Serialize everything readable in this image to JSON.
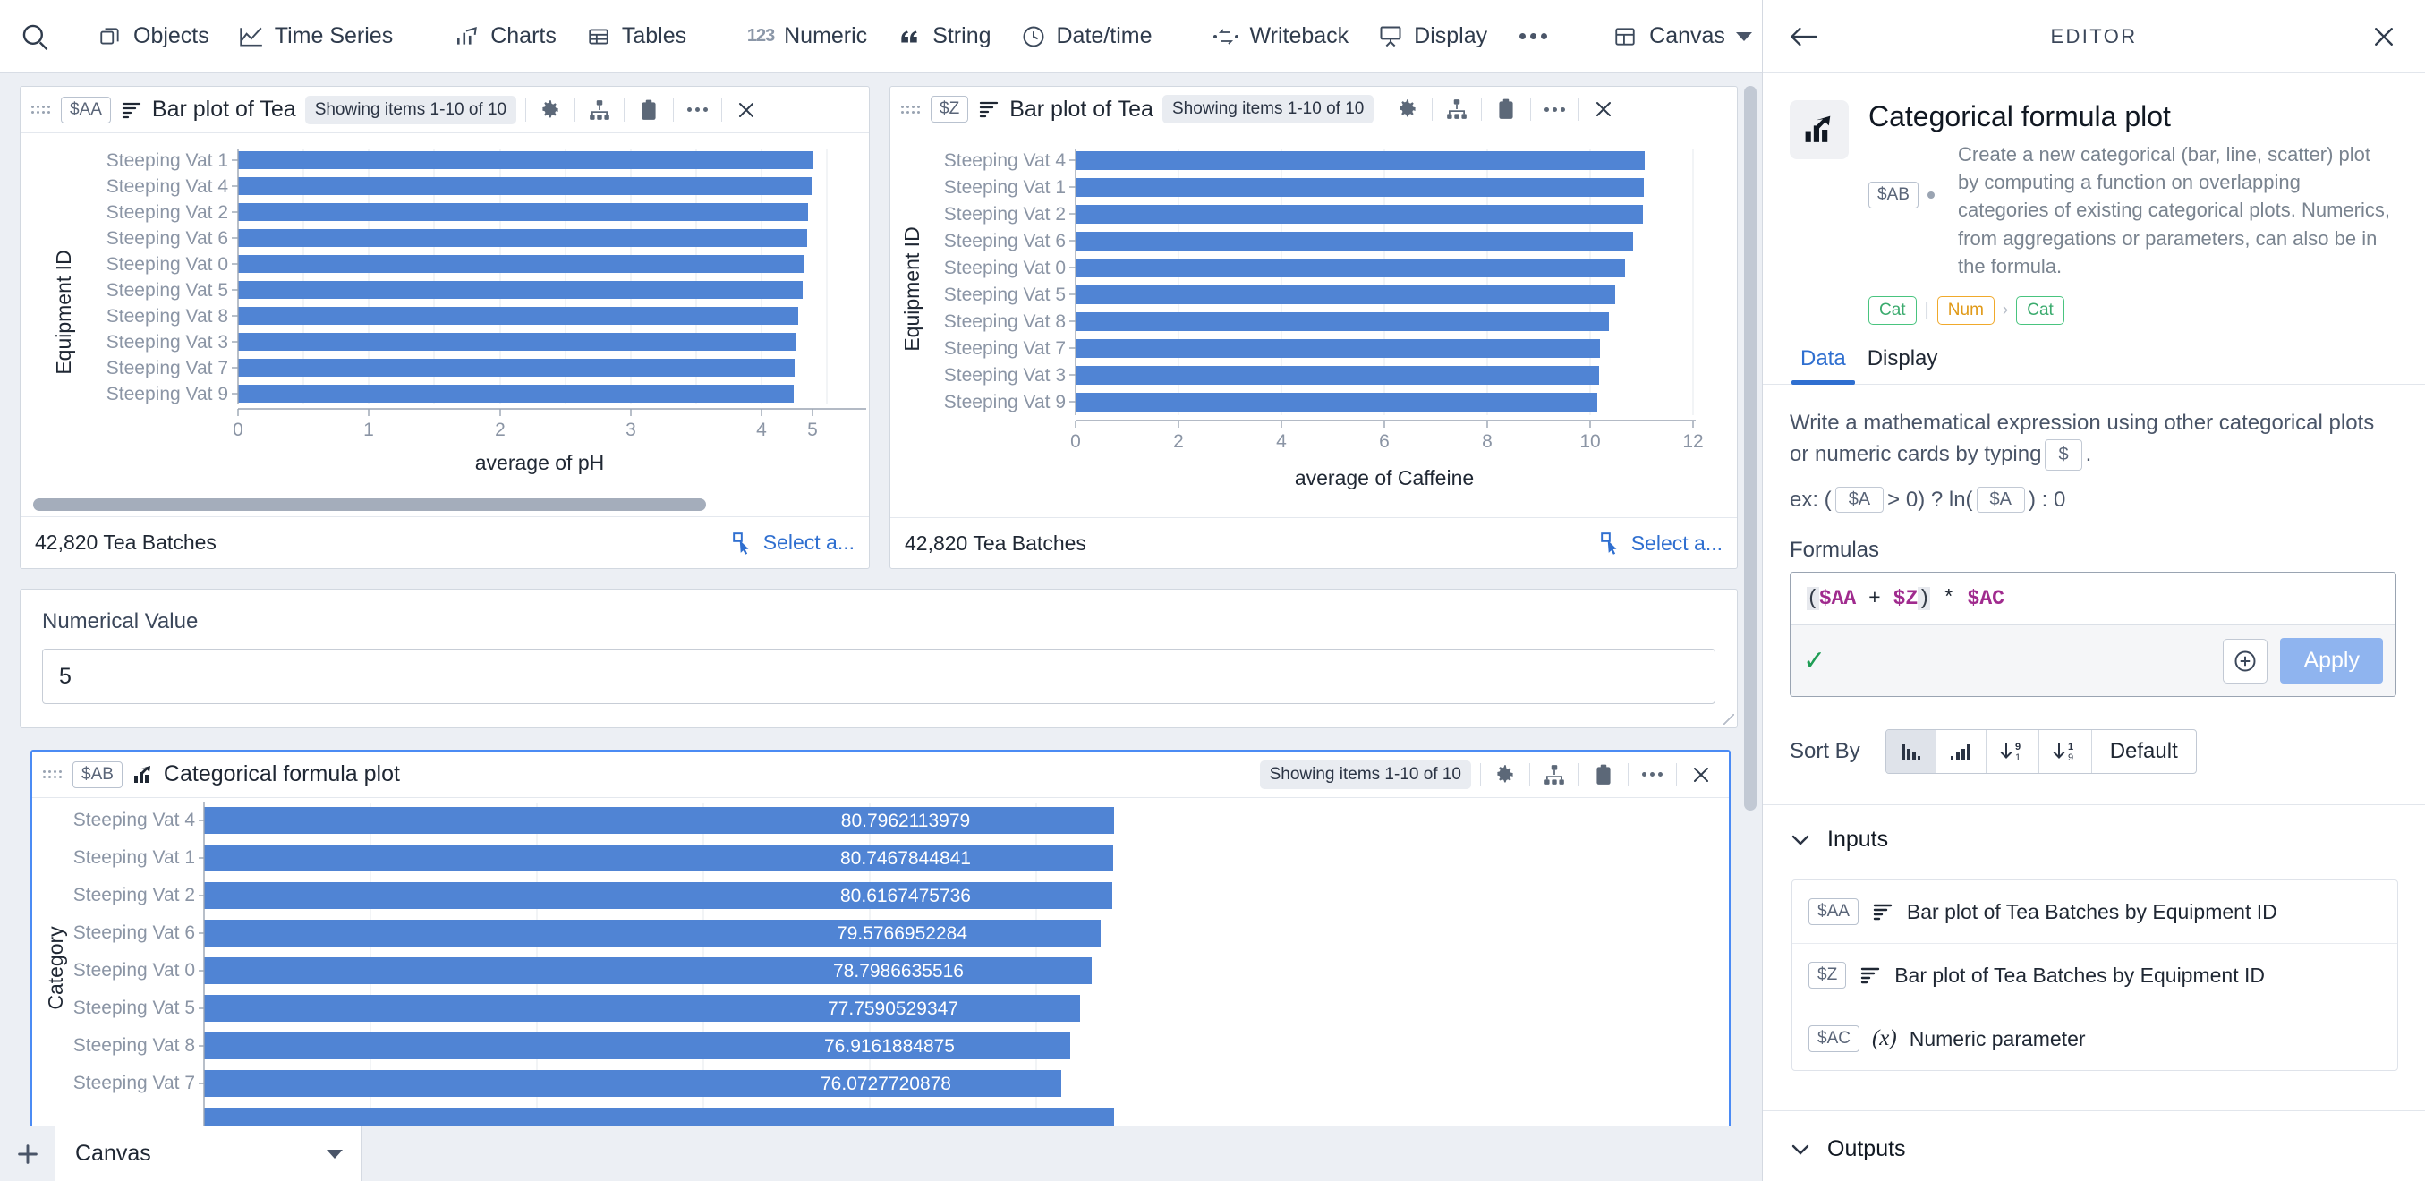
{
  "toolbar": {
    "search_icon": "search-icon",
    "items": [
      {
        "label": "Objects",
        "icon": "objects-icon"
      },
      {
        "label": "Time Series",
        "icon": "line-chart-icon"
      },
      {
        "label": "Charts",
        "icon": "bar-chart-icon"
      },
      {
        "label": "Tables",
        "icon": "table-icon"
      },
      {
        "label": "Numeric",
        "icon": "123-icon"
      },
      {
        "label": "String",
        "icon": "quote-icon"
      },
      {
        "label": "Date/time",
        "icon": "clock-icon"
      },
      {
        "label": "Writeback",
        "icon": "writeback-icon"
      },
      {
        "label": "Display",
        "icon": "presentation-icon"
      }
    ],
    "overflow_icon": "ellipsis-icon",
    "canvas_label": "Canvas",
    "canvas_caret": "chevron-down-icon"
  },
  "cards": [
    {
      "chip": "$AA",
      "title": "Bar plot of Tea",
      "showing": "Showing items 1-10 of 10",
      "footer_count": "42,820 Tea Batches",
      "footer_action": "Select a...",
      "has_scrollbar": true
    },
    {
      "chip": "$Z",
      "title": "Bar plot of Tea",
      "showing": "Showing items 1-10 of 10",
      "footer_count": "42,820 Tea Batches",
      "footer_action": "Select a...",
      "has_scrollbar": false
    }
  ],
  "numeric_card": {
    "label": "Numerical Value",
    "value": "5"
  },
  "formula_card": {
    "chip": "$AB",
    "title": "Categorical formula plot",
    "showing": "Showing items 1-10 of 10"
  },
  "bottom_bar": {
    "add_icon": "plus-icon",
    "tab_label": "Canvas",
    "tab_caret": "chevron-down-icon"
  },
  "editor": {
    "back_icon": "arrow-left-icon",
    "title": "EDITOR",
    "close_icon": "close-icon",
    "hero": {
      "icon": "trending-bar-icon",
      "title": "Categorical formula plot",
      "chip": "$AB",
      "description": "Create a new categorical (bar, line, scatter) plot by computing a function on overlapping categories of existing categorical plots. Numerics, from aggregations or parameters, can also be in the formula.",
      "type_in_a": "Cat",
      "type_in_b": "Num",
      "type_out": "Cat",
      "type_arrow": "›"
    },
    "tabs": [
      {
        "label": "Data",
        "active": true
      },
      {
        "label": "Display",
        "active": false
      }
    ],
    "help_text_1": "Write a mathematical expression using other categorical plots or numeric cards by typing",
    "help_chip": "$",
    "help_text_1_end": ".",
    "example_prefix": "ex: (",
    "example_chip_a": "$A",
    "example_mid": "> 0) ? ln(",
    "example_chip_b": "$A",
    "example_suffix": ") : 0",
    "formulas_label": "Formulas",
    "formula": {
      "open_paren": "(",
      "var1": "$AA",
      "op1": "+",
      "var2": "$Z",
      "close_paren": ")",
      "op2": "*",
      "var3": "$AC",
      "valid_icon": "check-icon",
      "add_icon": "plus-circle-icon",
      "apply_label": "Apply"
    },
    "sort": {
      "label": "Sort By",
      "options": [
        {
          "name": "sort-descending-bars",
          "active": true
        },
        {
          "name": "sort-ascending-bars",
          "active": false
        },
        {
          "name": "sort-9-to-1",
          "active": false,
          "top": "9",
          "bottom": "1"
        },
        {
          "name": "sort-1-to-9",
          "active": false,
          "top": "1",
          "bottom": "9"
        },
        {
          "name": "sort-default",
          "active": false,
          "label": "Default"
        }
      ]
    },
    "inputs": {
      "title": "Inputs",
      "chevron": "chevron-down-icon",
      "items": [
        {
          "chip": "$AA",
          "icon": "bar-plot-icon",
          "label": "Bar plot of Tea Batches by Equipment ID"
        },
        {
          "chip": "$Z",
          "icon": "bar-plot-icon",
          "label": "Bar plot of Tea Batches by Equipment ID"
        },
        {
          "chip": "$AC",
          "icon": "fx-icon",
          "label": "Numeric parameter"
        }
      ]
    },
    "outputs": {
      "title": "Outputs",
      "chevron": "chevron-down-icon"
    }
  },
  "colors": {
    "bar": "#5084d4",
    "accent": "#2f6fd0",
    "canvas_bg": "#eceff4",
    "chip_var": "#a02b8e",
    "valid_green": "#1f9d55",
    "cat_green": "#49c47f",
    "num_orange": "#f0a92b"
  },
  "chart_data": [
    {
      "type": "bar",
      "orientation": "horizontal",
      "title": "Bar plot of Tea",
      "ylabel": "Equipment ID",
      "xlabel": "average of pH",
      "xlim": [
        0,
        5.6
      ],
      "xticks": [
        0,
        1,
        2,
        3,
        4,
        5
      ],
      "grid": true,
      "categories": [
        "Steeping Vat 1",
        "Steeping Vat 4",
        "Steeping Vat 2",
        "Steeping Vat 6",
        "Steeping Vat 0",
        "Steeping Vat 5",
        "Steeping Vat 8",
        "Steeping Vat 3",
        "Steeping Vat 7",
        "Steeping Vat 9"
      ],
      "values": [
        5.11,
        5.1,
        5.07,
        5.06,
        5.03,
        5.02,
        4.98,
        4.96,
        4.95,
        4.94
      ]
    },
    {
      "type": "bar",
      "orientation": "horizontal",
      "title": "Bar plot of Tea",
      "ylabel": "Equipment ID",
      "xlabel": "average of Caffeine",
      "xlim": [
        0,
        12.2
      ],
      "xticks": [
        0,
        2,
        4,
        6,
        8,
        10,
        12
      ],
      "grid": true,
      "categories": [
        "Steeping Vat 4",
        "Steeping Vat 1",
        "Steeping Vat 2",
        "Steeping Vat 6",
        "Steeping Vat 0",
        "Steeping Vat 5",
        "Steeping Vat 8",
        "Steeping Vat 7",
        "Steeping Vat 3",
        "Steeping Vat 9"
      ],
      "values": [
        11.05,
        11.04,
        11.03,
        10.83,
        10.68,
        10.48,
        10.37,
        10.19,
        10.17,
        10.13
      ]
    },
    {
      "type": "bar",
      "orientation": "horizontal",
      "title": "Categorical formula plot",
      "ylabel": "Category",
      "xlabel": "",
      "xlim": [
        0,
        90
      ],
      "grid": true,
      "categories": [
        "Steeping Vat 4",
        "Steeping Vat 1",
        "Steeping Vat 2",
        "Steeping Vat 6",
        "Steeping Vat 0",
        "Steeping Vat 5",
        "Steeping Vat 8",
        "Steeping Vat 7"
      ],
      "values": [
        80.7962113979,
        80.7467844841,
        80.6167475736,
        79.5766952284,
        78.7986635516,
        77.7590529347,
        76.9161884875,
        76.0727720878
      ],
      "data_labels": [
        "80.7962113979",
        "80.7467844841",
        "80.6167475736",
        "79.5766952284",
        "78.7986635516",
        "77.7590529347",
        "76.9161884875",
        "76.0727720878"
      ]
    }
  ]
}
